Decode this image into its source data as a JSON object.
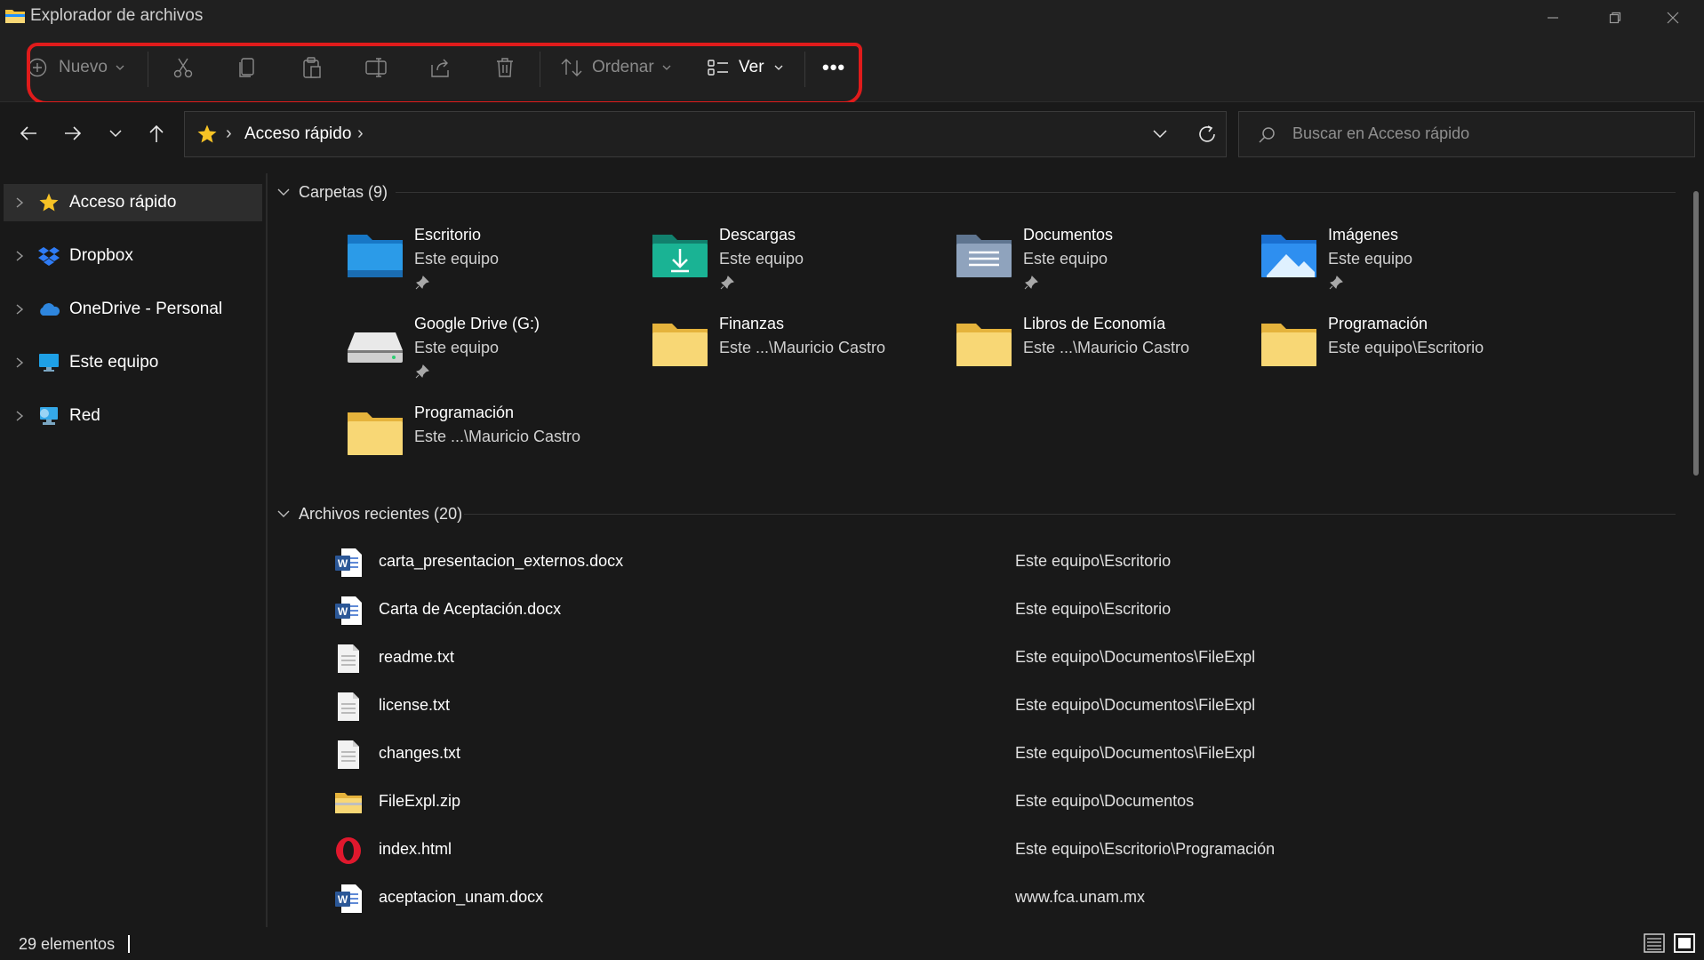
{
  "window": {
    "title": "Explorador de archivos"
  },
  "toolbar": {
    "new_label": "Nuevo",
    "sort_label": "Ordenar",
    "view_label": "Ver",
    "more_label": "•••"
  },
  "address": {
    "location": "Acceso rápido",
    "separator": "›"
  },
  "search": {
    "placeholder": "Buscar en Acceso rápido"
  },
  "sidebar": {
    "items": [
      {
        "label": "Acceso rápido",
        "icon": "star-icon",
        "selected": true
      },
      {
        "label": "Dropbox",
        "icon": "dropbox-icon",
        "selected": false
      },
      {
        "label": "OneDrive - Personal",
        "icon": "onedrive-cloud-icon",
        "selected": false
      },
      {
        "label": "Este equipo",
        "icon": "computer-icon",
        "selected": false
      },
      {
        "label": "Red",
        "icon": "network-icon",
        "selected": false
      }
    ]
  },
  "folders_group": {
    "label": "Carpetas (9)"
  },
  "folders": [
    {
      "name": "Escritorio",
      "location": "Este equipo",
      "pinned": true,
      "icon": "desktop-folder-icon"
    },
    {
      "name": "Descargas",
      "location": "Este equipo",
      "pinned": true,
      "icon": "downloads-folder-icon"
    },
    {
      "name": "Documentos",
      "location": "Este equipo",
      "pinned": true,
      "icon": "documents-folder-icon"
    },
    {
      "name": "Imágenes",
      "location": "Este equipo",
      "pinned": true,
      "icon": "pictures-folder-icon"
    },
    {
      "name": "Google Drive (G:)",
      "location": "Este equipo",
      "pinned": true,
      "icon": "drive-icon"
    },
    {
      "name": "Finanzas",
      "location": "Este ...\\Mauricio Castro",
      "pinned": false,
      "icon": "folder-icon"
    },
    {
      "name": "Libros de Economía",
      "location": "Este ...\\Mauricio Castro",
      "pinned": false,
      "icon": "folder-icon"
    },
    {
      "name": "Programación",
      "location": "Este equipo\\Escritorio",
      "pinned": false,
      "icon": "folder-icon"
    },
    {
      "name": "Programación",
      "location": "Este ...\\Mauricio Castro",
      "pinned": false,
      "icon": "folder-icon"
    }
  ],
  "recent_group": {
    "label": "Archivos recientes (20)"
  },
  "recent": [
    {
      "name": "carta_presentacion_externos.docx",
      "location": "Este equipo\\Escritorio",
      "icon": "word-doc-icon"
    },
    {
      "name": "Carta de Aceptación.docx",
      "location": "Este equipo\\Escritorio",
      "icon": "word-doc-icon"
    },
    {
      "name": "readme.txt",
      "location": "Este equipo\\Documentos\\FileExpl",
      "icon": "text-file-icon"
    },
    {
      "name": "license.txt",
      "location": "Este equipo\\Documentos\\FileExpl",
      "icon": "text-file-icon"
    },
    {
      "name": "changes.txt",
      "location": "Este equipo\\Documentos\\FileExpl",
      "icon": "text-file-icon"
    },
    {
      "name": "FileExpl.zip",
      "location": "Este equipo\\Documentos",
      "icon": "zip-folder-icon"
    },
    {
      "name": "index.html",
      "location": "Este equipo\\Escritorio\\Programación",
      "icon": "opera-icon"
    },
    {
      "name": "aceptacion_unam.docx",
      "location": "www.fca.unam.mx",
      "icon": "word-doc-icon"
    }
  ],
  "status": {
    "count": "29 elementos"
  },
  "colors": {
    "background": "#191919",
    "chrome": "#202020",
    "selection": "#2d2d2d",
    "folder_yellow": "#f8d775",
    "annotation_red": "#e01b1b"
  }
}
